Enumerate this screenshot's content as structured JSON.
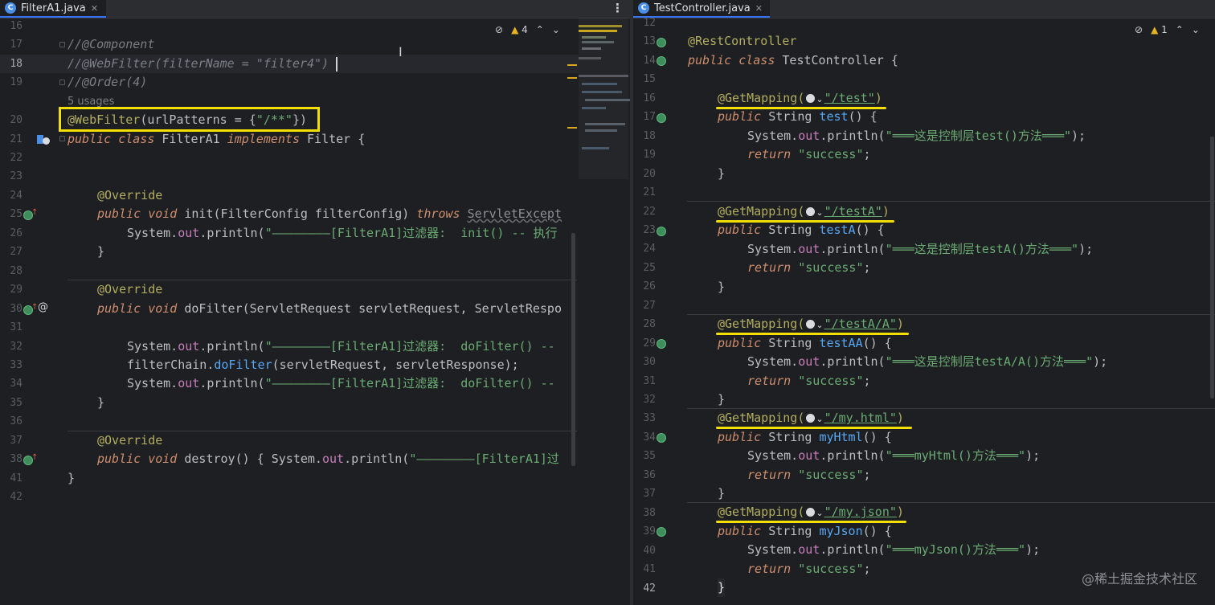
{
  "left": {
    "tab_title": "FilterA1.java",
    "tab_icon": "C",
    "tab_close": "✕",
    "kebab": "⋮",
    "inspection": {
      "warnings": "4"
    },
    "usages_hint": "5 usages",
    "lines": {
      "n16": "16",
      "n17": "17",
      "n18": "18",
      "n19": "19",
      "n20": "20",
      "n21": "21",
      "n22": "22",
      "n23": "23",
      "n24": "24",
      "n25": "25",
      "n26": "26",
      "n27": "27",
      "n28": "28",
      "n29": "29",
      "n30": "30",
      "n31": "31",
      "n32": "32",
      "n33": "33",
      "n34": "34",
      "n35": "35",
      "n36": "36",
      "n37": "37",
      "n38": "38",
      "n41": "41",
      "n42": "42"
    },
    "code": {
      "l17": "//@Component",
      "l18": "//@WebFilter(filterName = \"filter4\")",
      "l19": "//@Order(4)",
      "l20_ann": "@WebFilter",
      "l20_rest_a": "(urlPatterns = {",
      "l20_str": "\"/**\"",
      "l20_rest_b": "})",
      "l21_kw1": "public class",
      "l21_name": " FilterA1 ",
      "l21_kw2": "implements",
      "l21_rest": " Filter {",
      "l24": "@Override",
      "l25_kw": "public void",
      "l25_mid": " init(FilterConfig filterConfig) ",
      "l25_kw2": "throws",
      "l25_warn": "ServletExcept",
      "l26_a": "System.",
      "l26_fld": "out",
      "l26_b": ".println(",
      "l26_str": "\"————————[FilterA1]过滤器:  init() -- 执行",
      "l27": "}",
      "l29": "@Override",
      "l30_kw": "public void",
      "l30_rest": " doFilter(ServletRequest servletRequest, ServletRespo",
      "l32_a": "System.",
      "l32_fld": "out",
      "l32_b": ".println(",
      "l32_str": "\"————————[FilterA1]过滤器:  doFilter() --",
      "l33_a": "filterChain.",
      "l33_fn": "doFilter",
      "l33_b": "(servletRequest, servletResponse);",
      "l34_a": "System.",
      "l34_fld": "out",
      "l34_b": ".println(",
      "l34_str": "\"————————[FilterA1]过滤器:  doFilter() --",
      "l35": "}",
      "l37": "@Override",
      "l38_kw": "public void",
      "l38_mid": " destroy() { System.",
      "l38_fld": "out",
      "l38_b": ".println(",
      "l38_str": "\"————————[FilterA1]过",
      "l41": "}"
    }
  },
  "right": {
    "tab_title": "TestController.java",
    "tab_icon": "C",
    "tab_close": "✕",
    "inspection": {
      "warnings": "1"
    },
    "lines": {
      "n12": "12",
      "n13": "13",
      "n14": "14",
      "n15": "15",
      "n16": "16",
      "n17": "17",
      "n18": "18",
      "n19": "19",
      "n20": "20",
      "n21": "21",
      "n22": "22",
      "n23": "23",
      "n24": "24",
      "n25": "25",
      "n26": "26",
      "n27": "27",
      "n28": "28",
      "n29": "29",
      "n30": "30",
      "n31": "31",
      "n32": "32",
      "n33": "33",
      "n34": "34",
      "n35": "35",
      "n36": "36",
      "n37": "37",
      "n38": "38",
      "n39": "39",
      "n40": "40",
      "n41": "41",
      "n42": "42"
    },
    "code": {
      "l13": "@RestController",
      "l14_kw": "public class",
      "l14_rest": " TestController {",
      "annotation": "@GetMapping",
      "m1_url": "\"/test\"",
      "m1_sig_kw": "public",
      "m1_sig_type": " String ",
      "m1_sig_name": "test",
      "m1_sig_rest": "() {",
      "m1_print_str": "\"═══这是控制层test()方法═══\"",
      "m2_url": "\"/testA\"",
      "m2_sig_name": "testA",
      "m2_print_str": "\"═══这是控制层testA()方法═══\"",
      "m3_url": "\"/testA/A\"",
      "m3_sig_name": "testAA",
      "m3_print_str": "\"═══这是控制层testA/A()方法═══\"",
      "m4_url": "\"/my.html\"",
      "m4_sig_name": "myHtml",
      "m4_print_str": "\"═══myHtml()方法═══\"",
      "m5_url": "\"/my.json\"",
      "m5_sig_name": "myJson",
      "m5_print_str": "\"═══myJson()方法═══\"",
      "sys": "System.",
      "out": "out",
      "println": ".println(",
      "close_paren": ");",
      "return_kw": "return",
      "success": " \"success\"",
      "semi": ";",
      "brace_close": "}",
      "paren_close": ")",
      "paren_open": "(",
      "chev": "⌄"
    }
  },
  "watermark": "@稀土掘金技术社区",
  "colors": {
    "highlight_yellow": "#f4e000",
    "accent_blue": "#3574f0",
    "warning": "#e6b422"
  }
}
